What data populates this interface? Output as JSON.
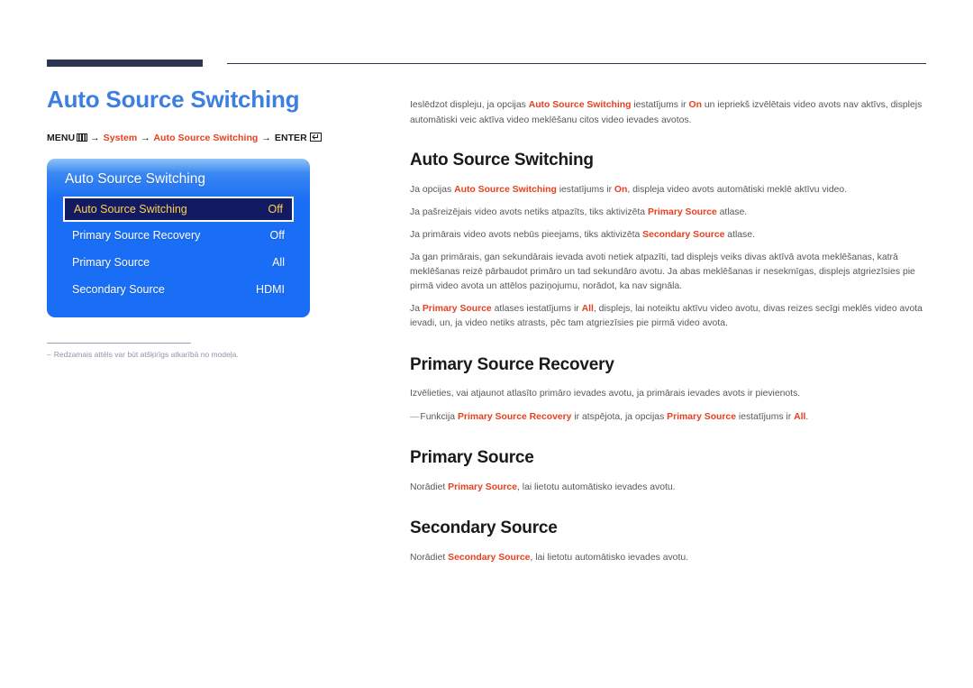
{
  "header": {
    "rule_color": "#2e3551"
  },
  "left": {
    "page_title": "Auto Source Switching",
    "breadcrumb": {
      "menu_label": "MENU",
      "menu_icon": "menu-grid-icon",
      "arrow": "→",
      "step1": "System",
      "step2": "Auto Source Switching",
      "enter_label": "ENTER",
      "enter_icon": "enter-key-icon"
    },
    "osd": {
      "title": "Auto Source Switching",
      "rows": [
        {
          "label": "Auto Source Switching",
          "value": "Off",
          "selected": true
        },
        {
          "label": "Primary Source Recovery",
          "value": "Off",
          "selected": false
        },
        {
          "label": "Primary Source",
          "value": "All",
          "selected": false
        },
        {
          "label": "Secondary Source",
          "value": "HDMI",
          "selected": false
        }
      ],
      "accent_blue": "#1a6ef5",
      "selected_bg": "#111a62",
      "selected_text": "#ffd24a"
    },
    "note": {
      "dash": "–",
      "text": "Redzamais attēls var būt atšķirīgs atkarībā no modeļa."
    }
  },
  "right": {
    "intro": {
      "p1_a": "Ieslēdzot displeju, ja opcijas ",
      "p1_b": "Auto Source Switching",
      "p1_c": " iestatījums ir ",
      "p1_d": "On",
      "p1_e": " un iepriekš izvēlētais video avots nav aktīvs, displejs automātiski veic aktīva video meklēšanu citos video ievades avotos."
    },
    "sections": [
      {
        "heading": "Auto Source Switching",
        "paragraphs": [
          {
            "parts": [
              {
                "t": "Ja opcijas ",
                "hl": false
              },
              {
                "t": "Auto Source Switching",
                "hl": true
              },
              {
                "t": " iestatījums ir ",
                "hl": false
              },
              {
                "t": "On",
                "hl": true
              },
              {
                "t": ", displeja video avots automātiski meklē aktīvu video.",
                "hl": false
              }
            ]
          },
          {
            "parts": [
              {
                "t": "Ja pašreizējais video avots netiks atpazīts, tiks aktivizēta ",
                "hl": false
              },
              {
                "t": "Primary Source",
                "hl": true
              },
              {
                "t": " atlase.",
                "hl": false
              }
            ]
          },
          {
            "parts": [
              {
                "t": "Ja primārais video avots nebūs pieejams, tiks aktivizēta ",
                "hl": false
              },
              {
                "t": "Secondary Source",
                "hl": true
              },
              {
                "t": " atlase.",
                "hl": false
              }
            ]
          },
          {
            "parts": [
              {
                "t": "Ja gan primārais, gan sekundārais ievada avoti netiek atpazīti, tad displejs veiks divas aktīvā avota meklēšanas, katrā meklēšanas reizē pārbaudot primāro un tad sekundāro avotu. Ja abas meklēšanas ir nesekmīgas, displejs atgriezīsies pie pirmā video avota un attēlos paziņojumu, norādot, ka nav signāla.",
                "hl": false
              }
            ]
          },
          {
            "parts": [
              {
                "t": "Ja ",
                "hl": false
              },
              {
                "t": "Primary Source",
                "hl": true
              },
              {
                "t": " atlases iestatījums ir ",
                "hl": false
              },
              {
                "t": "All",
                "hl": true
              },
              {
                "t": ", displejs, lai noteiktu aktīvu video avotu, divas reizes secīgi meklēs video avota ievadi, un, ja video netiks atrasts, pēc tam atgriezīsies pie pirmā video avota.",
                "hl": false
              }
            ]
          }
        ]
      },
      {
        "heading": "Primary Source Recovery",
        "paragraphs": [
          {
            "parts": [
              {
                "t": "Izvēlieties, vai atjaunot atlasīto primāro ievades avotu, ja primārais ievades avots ir pievienots.",
                "hl": false
              }
            ]
          },
          {
            "dash": true,
            "parts": [
              {
                "t": "Funkcija ",
                "hl": false
              },
              {
                "t": "Primary Source Recovery",
                "hl": true
              },
              {
                "t": " ir atspējota, ja opcijas ",
                "hl": false
              },
              {
                "t": "Primary Source",
                "hl": true
              },
              {
                "t": " iestatījums ir ",
                "hl": false
              },
              {
                "t": "All",
                "hl": true
              },
              {
                "t": ".",
                "hl": false
              }
            ]
          }
        ]
      },
      {
        "heading": "Primary Source",
        "paragraphs": [
          {
            "parts": [
              {
                "t": "Norādiet ",
                "hl": false
              },
              {
                "t": "Primary Source",
                "hl": true
              },
              {
                "t": ", lai lietotu automātisko ievades avotu.",
                "hl": false
              }
            ]
          }
        ]
      },
      {
        "heading": "Secondary Source",
        "paragraphs": [
          {
            "parts": [
              {
                "t": "Norādiet ",
                "hl": false
              },
              {
                "t": "Secondary Source",
                "hl": true
              },
              {
                "t": ", lai lietotu automātisko ievades avotu.",
                "hl": false
              }
            ]
          }
        ]
      }
    ],
    "accent_red": "#e8401f"
  }
}
